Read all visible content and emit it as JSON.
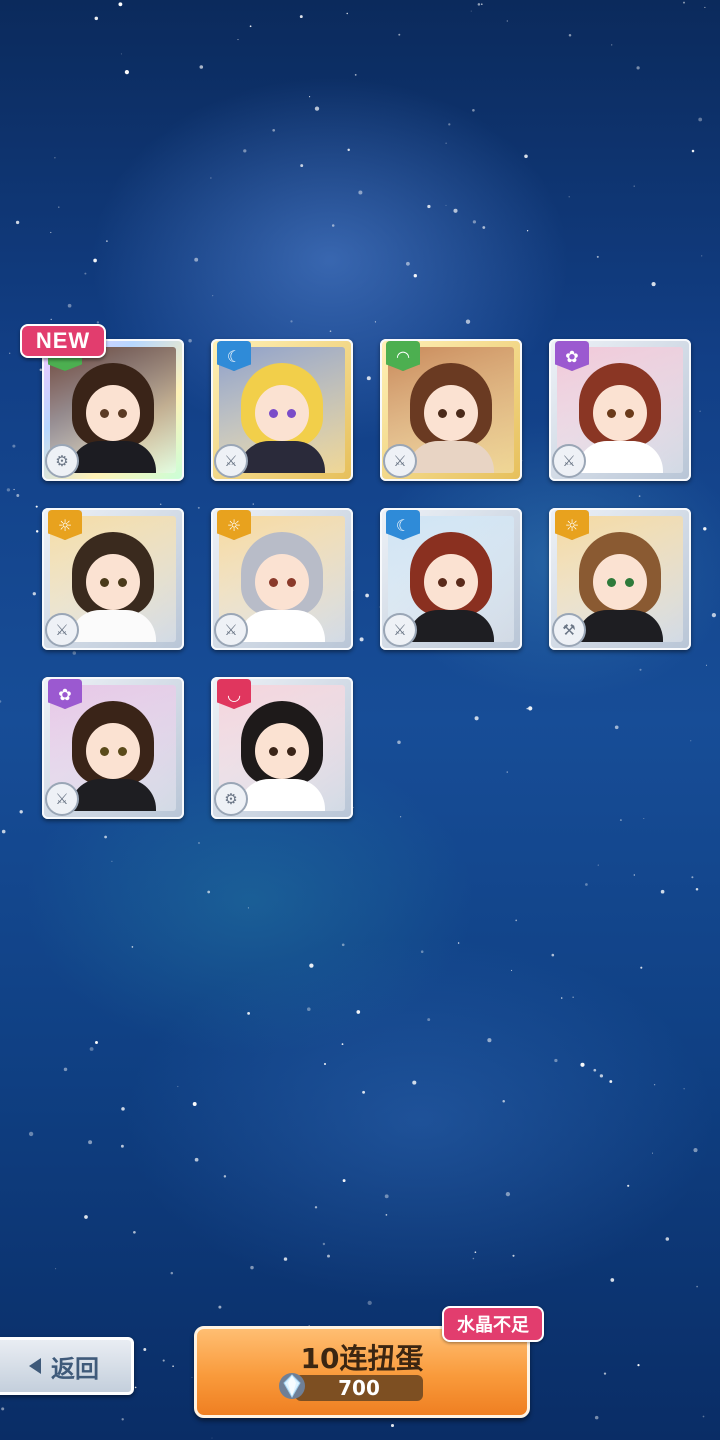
{
  "new_label": "NEW",
  "cards": [
    {
      "id": 1,
      "attr_icon": "leaf-icon",
      "attr_color": "#4caf50",
      "frame": "rainbow",
      "bg": "#6b4a3c",
      "hair": "#3a2418",
      "outfit": "#1c1c22",
      "eye": "#5a3a24",
      "role_icon": "gear-icon",
      "is_new": true
    },
    {
      "id": 2,
      "attr_icon": "moon-icon",
      "attr_color": "#2f8bd8",
      "frame": "gold",
      "bg": "#8fa0c8",
      "hair": "#f2cf4a",
      "outfit": "#2a2a3a",
      "eye": "#7a4cc8",
      "role_icon": "sword-icon",
      "is_new": false
    },
    {
      "id": 3,
      "attr_icon": "leaf-icon",
      "attr_color": "#4caf50",
      "frame": "gold",
      "bg": "#c98a5a",
      "hair": "#6a3a22",
      "outfit": "#e8d4c4",
      "eye": "#4a2a1a",
      "role_icon": "sword-icon",
      "is_new": false
    },
    {
      "id": 4,
      "attr_icon": "flower-icon",
      "attr_color": "#9b59d0",
      "frame": "silver",
      "bg": "#f0c8d8",
      "hair": "#8a3624",
      "outfit": "#ffffff",
      "eye": "#6a3a1a",
      "role_icon": "sword-icon",
      "is_new": false
    },
    {
      "id": 5,
      "attr_icon": "sun-icon",
      "attr_color": "#e8a21e",
      "frame": "silver",
      "bg": "#f4dca6",
      "hair": "#3a2a1e",
      "outfit": "#fbfbfb",
      "eye": "#4a3a1a",
      "role_icon": "sword-icon",
      "is_new": false
    },
    {
      "id": 6,
      "attr_icon": "sun-icon",
      "attr_color": "#e8a21e",
      "frame": "silver",
      "bg": "#f6d9a0",
      "hair": "#b8bcc8",
      "outfit": "#ffffff",
      "eye": "#8a3a2a",
      "role_icon": "sword-icon",
      "is_new": false
    },
    {
      "id": 7,
      "attr_icon": "moon-icon",
      "attr_color": "#2f8bd8",
      "frame": "silver",
      "bg": "#cfe4f4",
      "hair": "#8a3020",
      "outfit": "#1e1e22",
      "eye": "#5a2a1a",
      "role_icon": "sword-icon",
      "is_new": false
    },
    {
      "id": 8,
      "attr_icon": "sun-icon",
      "attr_color": "#e8a21e",
      "frame": "silver",
      "bg": "#f4d9a2",
      "hair": "#8a5a32",
      "outfit": "#1e1e22",
      "eye": "#2e7a3a",
      "role_icon": "hammer-icon",
      "is_new": false
    },
    {
      "id": 9,
      "attr_icon": "flower-icon",
      "attr_color": "#9b59d0",
      "frame": "silver",
      "bg": "#e6c6e6",
      "hair": "#3a2418",
      "outfit": "#1e1e22",
      "eye": "#5a4a1a",
      "role_icon": "sword-icon",
      "is_new": false
    },
    {
      "id": 10,
      "attr_icon": "crescent-icon",
      "attr_color": "#e0365e",
      "frame": "silver",
      "bg": "#f4d4dc",
      "hair": "#1e1a1a",
      "outfit": "#ffffff",
      "eye": "#3a2418",
      "role_icon": "gear-icon",
      "is_new": false
    }
  ],
  "back_button": {
    "label": "返回"
  },
  "gacha_button": {
    "label": "10连扭蛋",
    "cost": "700",
    "currency_icon": "crystal-icon"
  },
  "warning_badge": {
    "label": "水晶不足"
  }
}
